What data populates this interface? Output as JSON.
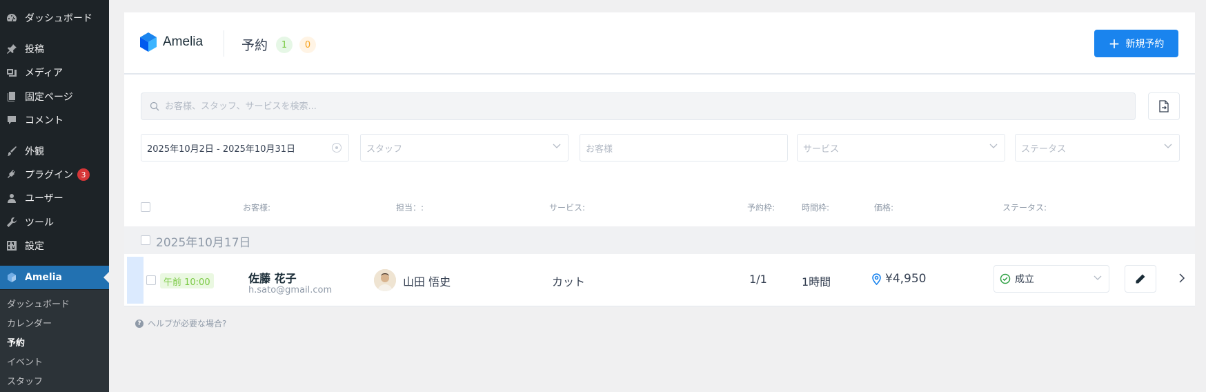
{
  "sidebar": {
    "items": [
      {
        "label": "ダッシュボード",
        "icon": "dashboard-icon"
      },
      {
        "label": "投稿",
        "icon": "pin-icon"
      },
      {
        "label": "メディア",
        "icon": "media-icon"
      },
      {
        "label": "固定ページ",
        "icon": "page-icon"
      },
      {
        "label": "コメント",
        "icon": "comment-icon"
      },
      {
        "label": "外観",
        "icon": "brush-icon"
      },
      {
        "label": "プラグイン",
        "icon": "plugin-icon",
        "badge": "3"
      },
      {
        "label": "ユーザー",
        "icon": "user-icon"
      },
      {
        "label": "ツール",
        "icon": "wrench-icon"
      },
      {
        "label": "設定",
        "icon": "settings-icon"
      },
      {
        "label": "Amelia",
        "icon": "amelia-icon"
      }
    ],
    "submenu": [
      "ダッシュボード",
      "カレンダー",
      "予約",
      "イベント",
      "スタッフ"
    ]
  },
  "header": {
    "logo_text": "Amelia",
    "title": "予約",
    "count_green": "1",
    "count_orange": "0",
    "new_button": "新規予約"
  },
  "search": {
    "placeholder": "お客様、スタッフ、サービスを検索..."
  },
  "filters": {
    "date_range": "2025年10月2日 - 2025年10月31日",
    "staff_placeholder": "スタッフ",
    "customer_placeholder": "お客様",
    "service_placeholder": "サービス",
    "status_placeholder": "ステータス"
  },
  "table": {
    "headers": {
      "customer": "お客様:",
      "staff": "担当：:",
      "service": "サービス:",
      "capacity": "予約枠:",
      "duration": "時間枠:",
      "price": "価格:",
      "status": "ステータス:"
    },
    "group_date": "2025年10月17日",
    "rows": [
      {
        "time": "午前 10:00",
        "customer_name": "佐藤 花子",
        "customer_email": "h.sato@gmail.com",
        "staff_name": "山田 悟史",
        "service": "カット",
        "capacity": "1/1",
        "duration": "1時間",
        "price": "¥4,950",
        "status": "成立"
      }
    ]
  },
  "help": "ヘルプが必要な場合?",
  "colors": {
    "accent": "#1a84ee",
    "sidebar_bg": "#1d2327",
    "active_menu": "#2271b1",
    "status_green": "#7ac943",
    "badge_orange": "#f7a21b"
  }
}
